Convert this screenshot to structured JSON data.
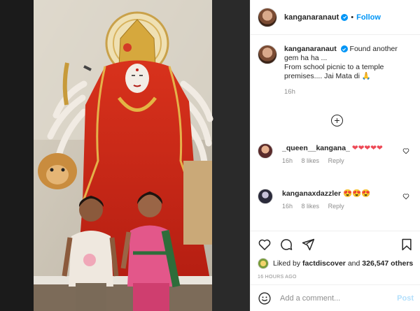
{
  "photo": {
    "alt_icon": "temple-photo",
    "subject": "photo-of-durga-idol-with-two-children"
  },
  "header": {
    "username": "kanganaranaut",
    "separator": "•",
    "follow_label": "Follow",
    "verified_icon": "verified-badge-icon"
  },
  "caption": {
    "username": "kanganaranaut",
    "text_line1": "Found another gem ha ha ...",
    "text_line2": "From school picnic to a temple premises.... Jai Mata di 🙏",
    "time": "16h"
  },
  "load_more_icon": "plus-circle-icon",
  "load_more_label": "+",
  "comments": [
    {
      "username": "_queen__kangana_",
      "text": "❤❤❤❤❤",
      "time": "16h",
      "likes": "8 likes",
      "reply": "Reply"
    },
    {
      "username": "kanganaxdazzler",
      "text": "😍😍😍",
      "time": "16h",
      "likes": "8 likes",
      "reply": "Reply"
    }
  ],
  "actions": {
    "icons": [
      "heart-icon",
      "comment-icon",
      "share-icon",
      "bookmark-icon"
    ]
  },
  "likes": {
    "prefix": "Liked by",
    "user": "factdiscover",
    "middle": "and",
    "count": "326,547 others"
  },
  "timestamp": "16 HOURS AGO",
  "add_comment": {
    "placeholder": "Add a comment...",
    "post_label": "Post"
  },
  "colors": {
    "accent": "#0095f6",
    "post_disabled": "#b2dffc",
    "muted": "#8e8e8e",
    "heart": "#ed4956"
  }
}
